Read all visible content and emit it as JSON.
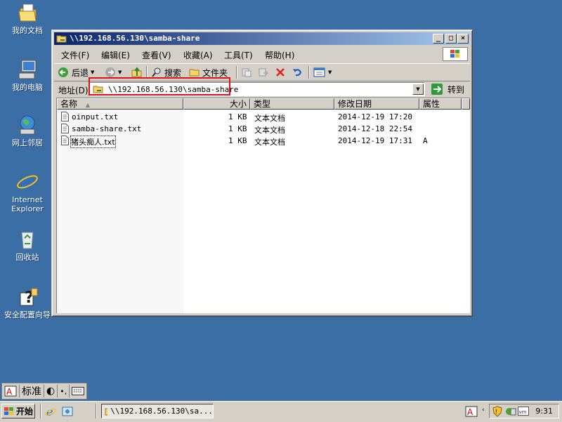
{
  "desktop": {
    "icons": [
      {
        "label": "我的文档"
      },
      {
        "label": "我的电脑"
      },
      {
        "label": "网上邻居"
      },
      {
        "label": "Internet Explorer"
      },
      {
        "label": "回收站"
      },
      {
        "label": "安全配置向导"
      }
    ]
  },
  "window": {
    "title": "\\\\192.168.56.130\\samba-share",
    "menu": [
      "文件(F)",
      "编辑(E)",
      "查看(V)",
      "收藏(A)",
      "工具(T)",
      "帮助(H)"
    ],
    "toolbar": {
      "back_label": "后退",
      "search_label": "搜索",
      "folders_label": "文件夹"
    },
    "address": {
      "label": "地址(D)",
      "value": "\\\\192.168.56.130\\samba-share",
      "go_label": "转到"
    },
    "columns": [
      "名称",
      "大小",
      "类型",
      "修改日期",
      "属性"
    ],
    "files": [
      {
        "name": "oinput.txt",
        "size": "1 KB",
        "type": "文本文档",
        "modified": "2014-12-19 17:20",
        "attr": ""
      },
      {
        "name": "samba-share.txt",
        "size": "1 KB",
        "type": "文本文档",
        "modified": "2014-12-18 22:54",
        "attr": ""
      },
      {
        "name": "猪头痴人.txt",
        "size": "1 KB",
        "type": "文本文档",
        "modified": "2014-12-19 17:31",
        "attr": "A"
      }
    ]
  },
  "ime": {
    "label": "标准"
  },
  "taskbar": {
    "start_label": "开始",
    "task_label": "\\\\192.168.56.130\\sa...",
    "clock": "9:31"
  },
  "colors": {
    "desktop": "#3a6ea5",
    "titlebar": "#0a246a",
    "highlight": "#e0101a"
  }
}
